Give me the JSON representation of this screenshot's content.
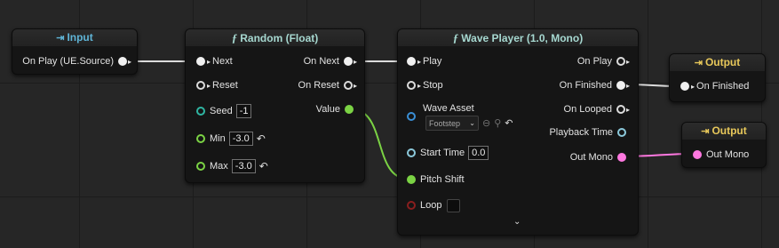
{
  "nodes": {
    "input": {
      "title": "Input",
      "icon": "input-arrow-icon",
      "output_pin": "On Play (UE.Source)"
    },
    "random": {
      "title": "Random (Float)",
      "fn_glyph": "ƒ",
      "inputs": {
        "next": "Next",
        "reset": "Reset",
        "seed": "Seed",
        "seed_value": "-1",
        "min": "Min",
        "min_value": "-3.0",
        "max": "Max",
        "max_value": "-3.0"
      },
      "outputs": {
        "on_next": "On Next",
        "on_reset": "On Reset",
        "value": "Value"
      }
    },
    "wave_player": {
      "title": "Wave Player (1.0, Mono)",
      "fn_glyph": "ƒ",
      "inputs": {
        "play": "Play",
        "stop": "Stop",
        "wave_asset": "Wave Asset",
        "wave_asset_value": "Footstep",
        "start_time": "Start Time",
        "start_time_value": "0.0",
        "pitch_shift": "Pitch Shift",
        "loop": "Loop"
      },
      "outputs": {
        "on_play": "On Play",
        "on_finished": "On Finished",
        "on_looped": "On Looped",
        "playback_time": "Playback Time",
        "out_mono": "Out Mono"
      }
    },
    "output_finished": {
      "title": "Output",
      "icon": "output-arrow-icon",
      "input_pin": "On Finished"
    },
    "output_mono": {
      "title": "Output",
      "icon": "output-arrow-icon",
      "input_pin": "Out Mono"
    }
  },
  "glyphs": {
    "reset": "↶",
    "caret": "⌄",
    "browse": "⊖",
    "search": "🔍",
    "expand": "⌄"
  },
  "colors": {
    "exec_wire": "#dcdcdc",
    "float_wire": "#7bd344",
    "audio_wire": "#ff78e0",
    "input_title": "#5fb4d6",
    "output_title": "#e8c85a"
  }
}
